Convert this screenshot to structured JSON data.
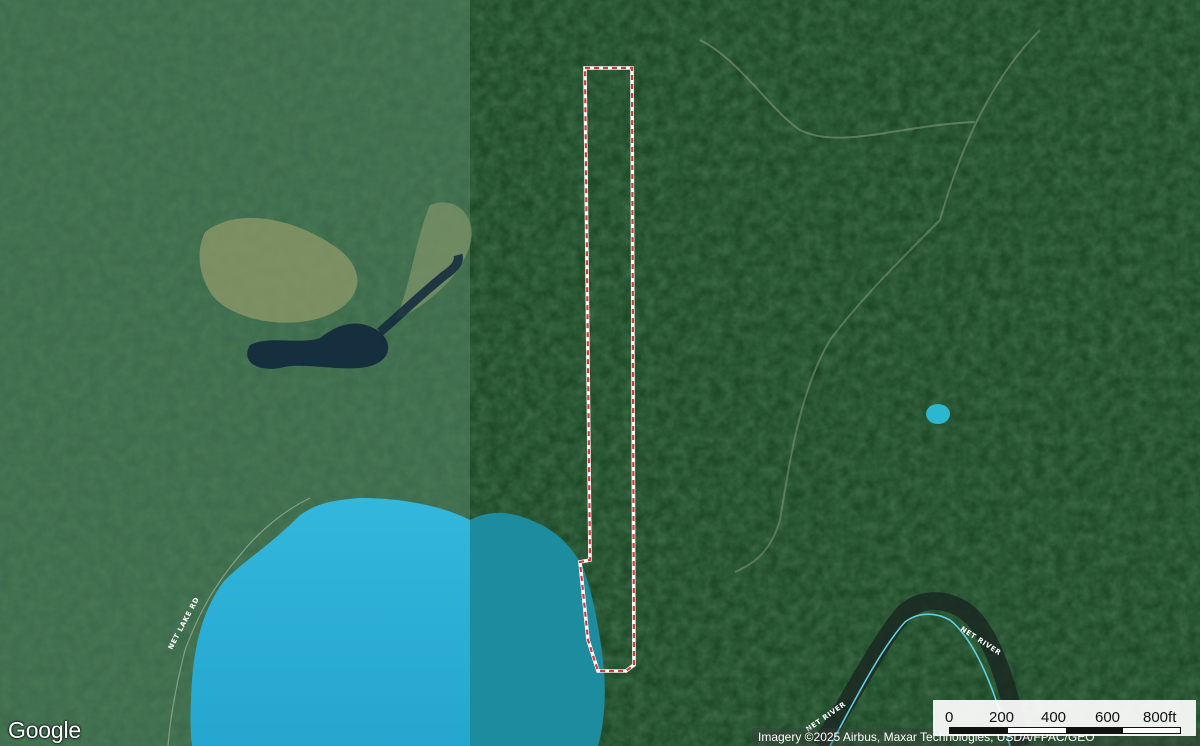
{
  "map": {
    "branding": "Google",
    "attribution": "Imagery ©2025 Airbus, Maxar Technologies, USDA/FPAC/GEO",
    "roads": [
      {
        "name": "NET LAKE RD"
      },
      {
        "name": "NET RIVER"
      },
      {
        "name": "NET RIVER"
      }
    ],
    "scale": {
      "labels": [
        "0",
        "200",
        "400",
        "600",
        "800ft"
      ]
    },
    "colors": {
      "water": "#2fb3d6",
      "boundary": "#d23b3b",
      "forest": "#26502e",
      "river_line": "#5fd0e6"
    }
  }
}
